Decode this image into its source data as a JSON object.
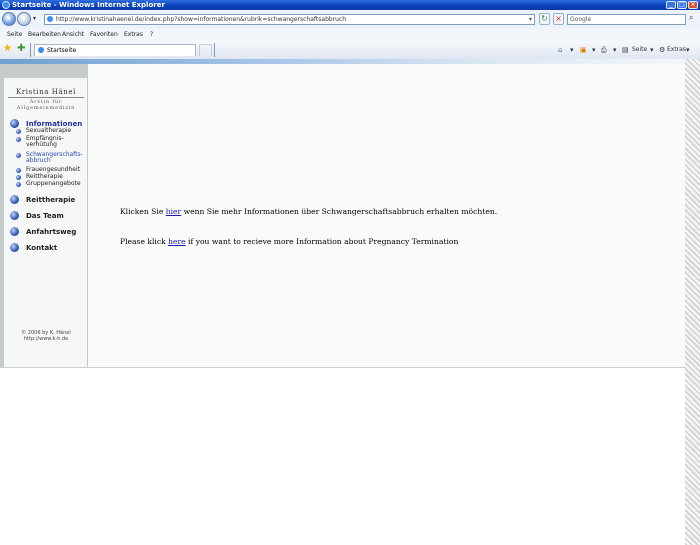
{
  "window": {
    "title": "Startseite - Windows Internet Explorer"
  },
  "address_bar": {
    "url": "http://www.kristinahaenel.de/index.php?show=informationen&rubrik=schwangerschaftsabbruch",
    "search_placeholder": "Google"
  },
  "menu": {
    "items": [
      "Seite",
      "Bearbeiten",
      "Ansicht",
      "Favoriten",
      "Extras",
      "?"
    ]
  },
  "tabs": {
    "active_label": "Startseite"
  },
  "toolbar": {
    "page_label": "Seite",
    "tools_label": "Extras"
  },
  "sidebar": {
    "logo_name": "Kristina Hänel",
    "logo_subtitle": "Ärztin für Allgemeinmedizin",
    "nav": [
      {
        "label": "Informationen"
      },
      {
        "label": "Reittherapie"
      },
      {
        "label": "Das Team"
      },
      {
        "label": "Anfahrtsweg"
      },
      {
        "label": "Kontakt"
      }
    ],
    "subnav": [
      {
        "line1": "Sexualtherapie",
        "line2": ""
      },
      {
        "line1": "Empfängnis-",
        "line2": "verhütung"
      },
      {
        "line1": "Schwangerschafts-",
        "line2": "abbruch"
      },
      {
        "line1": "Frauengesundheit",
        "line2": ""
      },
      {
        "line1": "Reittherapie",
        "line2": ""
      },
      {
        "line1": "Gruppenangebote",
        "line2": ""
      }
    ],
    "copyright_line1": "© 2006 by K. Hänel",
    "copyright_line2": "http://www.k-h.de"
  },
  "content": {
    "de_prefix": "Klicken Sie",
    "de_link": "hier",
    "de_suffix": "wenn Sie mehr Informationen über Schwangerschaftsabbruch erhalten möchten.",
    "en_prefix": "Please klick",
    "en_link": "here",
    "en_suffix": "if you want to recieve more Information about Pregnancy Termination"
  }
}
